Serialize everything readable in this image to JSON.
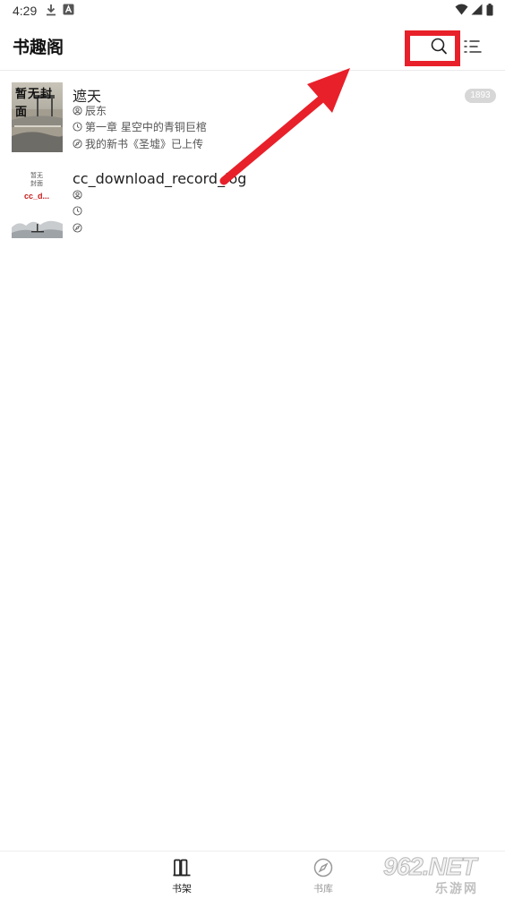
{
  "status_bar": {
    "time": "4:29",
    "icons": [
      "download-icon",
      "a-notification-icon",
      "wifi-icon",
      "signal-icon",
      "battery-icon"
    ]
  },
  "header": {
    "title": "书趣阁",
    "actions": [
      "search-icon",
      "menu-list-icon"
    ]
  },
  "books": [
    {
      "title": "遮天",
      "author": "辰东",
      "latest_chapter": "第一章 星空中的青铜巨棺",
      "update": "我的新书《圣墟》已上传",
      "badge": "1893",
      "cover_text": "暂无封面"
    },
    {
      "title": "cc_download_record_log",
      "author": "",
      "latest_chapter": "",
      "update": "",
      "cover_text": "暂无封面",
      "cover_title": "cc_d..."
    }
  ],
  "bottom_nav": [
    {
      "label": "书架",
      "icon": "bookshelf-icon",
      "active": true
    },
    {
      "label": "书库",
      "icon": "compass-icon",
      "active": false
    }
  ],
  "watermark": {
    "main": "962.NET",
    "sub": "乐游网"
  },
  "colors": {
    "highlight": "#e8202a",
    "arrow": "#e8202a",
    "badge": "#d7d7d7",
    "active_nav": "#222222",
    "inactive_nav": "#999999"
  }
}
